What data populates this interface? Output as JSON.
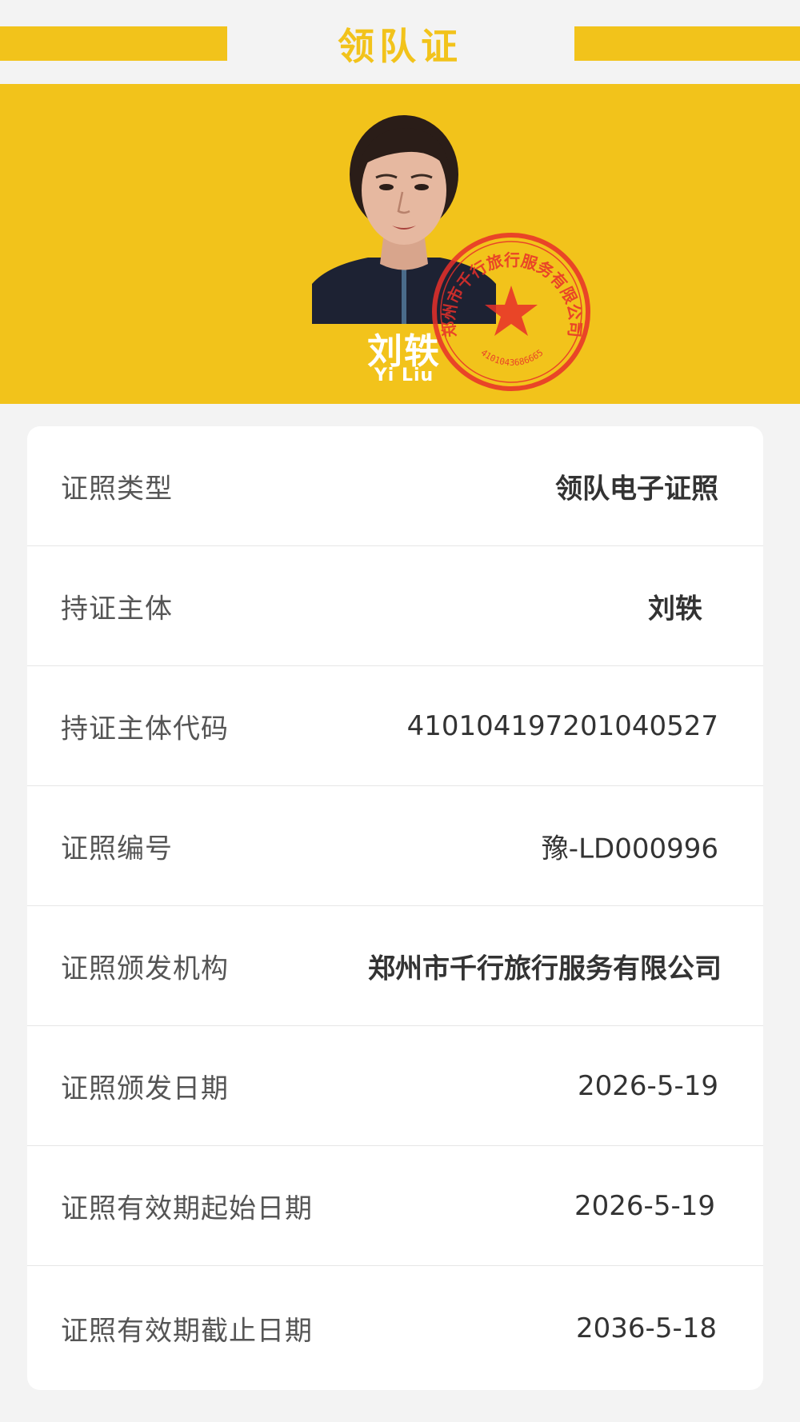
{
  "header": {
    "title": "领队证"
  },
  "holder": {
    "name_cn": "刘轶",
    "name_en": "Yi Liu",
    "photo_icon": "portrait-photo"
  },
  "seal": {
    "text": "郑州市千行旅行服务有限公司",
    "code": "4101043686665",
    "color": "#e8302a"
  },
  "rows": [
    {
      "label": "证照类型",
      "value": "领队电子证照"
    },
    {
      "label": "持证主体",
      "value": "刘轶"
    },
    {
      "label": "持证主体代码",
      "value": "410104197201040527"
    },
    {
      "label": "证照编号",
      "value": "豫-LD000996"
    },
    {
      "label": "证照颁发机构",
      "value": "郑州市千行旅行服务有限公司"
    },
    {
      "label": "证照颁发日期",
      "value": "2026-5-19"
    },
    {
      "label": "证照有效期起始日期",
      "value": "2026-5-19"
    },
    {
      "label": "证照有效期截止日期",
      "value": "2036-5-18"
    }
  ],
  "colors": {
    "accent": "#f2c31b",
    "background": "#f3f3f3",
    "card": "#ffffff",
    "seal": "#e8302a"
  }
}
